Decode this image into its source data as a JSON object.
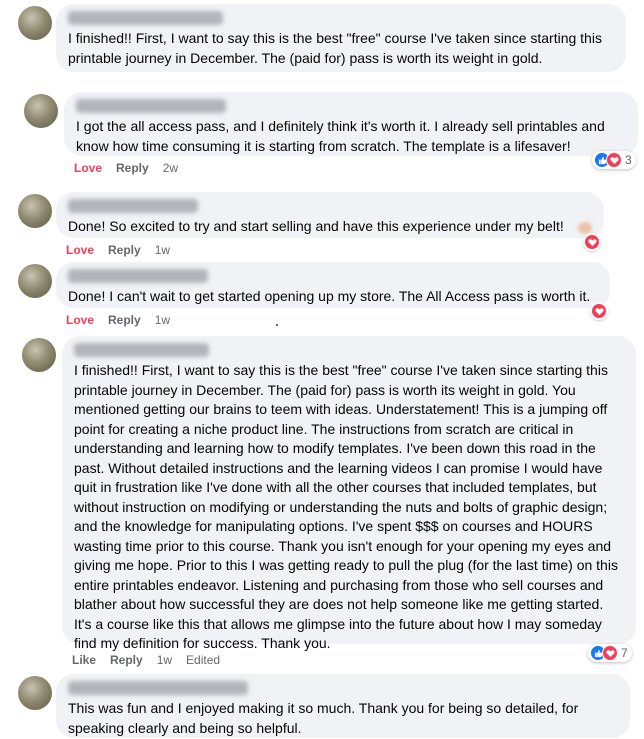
{
  "comments": [
    {
      "text": "I finished!! First, I want to say this is the best \"free\" course I've taken since starting this printable journey in December. The (paid for) pass is worth its weight in gold."
    },
    {
      "text": "I got the all access pass, and I definitely think it's worth it. I already sell printables and know how time consuming it is starting from scratch. The template is a lifesaver!",
      "actions": {
        "love": "Love",
        "reply": "Reply",
        "time": "2w"
      },
      "reaction_count": "3"
    },
    {
      "text": "Done! So excited to try and start selling and have this experience under my belt!",
      "actions": {
        "love": "Love",
        "reply": "Reply",
        "time": "1w"
      }
    },
    {
      "text": "Done! I can't wait to get started opening up my store. The All Access pass is worth it.",
      "actions": {
        "love": "Love",
        "reply": "Reply",
        "time": "1w"
      }
    },
    {
      "text": "I finished!! First, I want to say this is the best \"free\" course I've taken since starting this printable journey in December. The (paid for) pass is worth its weight in gold. You mentioned getting our brains to teem with ideas. Understatement! This is a jumping off point for creating a niche product line. The instructions from scratch are critical in understanding and learning how to modify templates. I've been down this road in the past. Without detailed instructions and the learning videos I can promise I would have quit in frustration like I've done with all the other courses that included templates, but without instruction on modifying or understanding the nuts and bolts of graphic design; and the knowledge for manipulating options. I've spent $$$ on courses and HOURS wasting time prior to this course. Thank you isn't enough for your opening my eyes and giving me hope. Prior to this I was getting ready to pull the plug (for the last time) on this entire printables endeavor. Listening and purchasing from those who sell courses and blather about how successful they are does not help someone like me getting started. It's a course like this that allows me glimpse into the future about how I may someday find my definition for success. Thank you.",
      "actions": {
        "like": "Like",
        "reply": "Reply",
        "time": "1w",
        "edited": "Edited"
      },
      "reaction_count": "7"
    },
    {
      "text": "This was fun and I enjoyed making it so much. Thank you for being so detailed, for speaking clearly and being so helpful."
    }
  ],
  "colors": {
    "love": "#f33e58",
    "like": "#1877f2",
    "bubble": "#f0f2f5",
    "meta": "#65676b"
  }
}
